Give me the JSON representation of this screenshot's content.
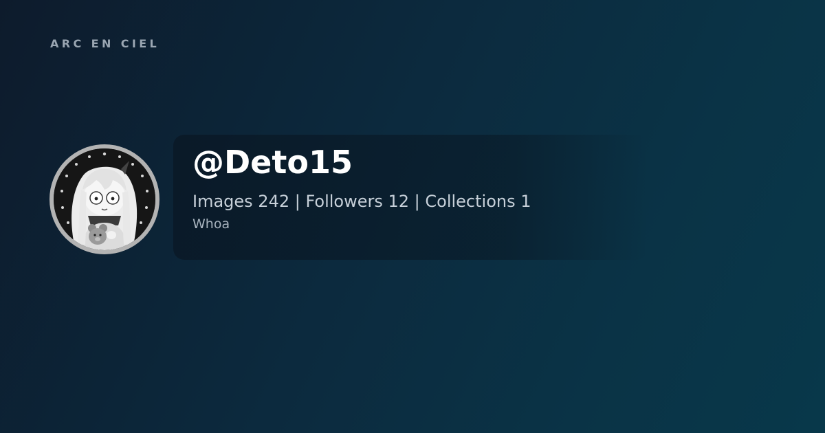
{
  "site": {
    "brand": "ARC EN CIEL"
  },
  "profile": {
    "username": "@Deto15",
    "stats": "Images 242 | Followers 12 | Collections 1",
    "bio": "Whoa"
  },
  "icons": {
    "avatar": "avatar-image"
  },
  "colors": {
    "background_start": "#0d1b2c",
    "background_end": "#08384a",
    "card": "#081420",
    "username": "#ffffff",
    "stats": "#c7d0d9",
    "bio": "#a9b4bf",
    "brand": "#9aa6b2",
    "avatar_border": "#b3b3b3"
  }
}
